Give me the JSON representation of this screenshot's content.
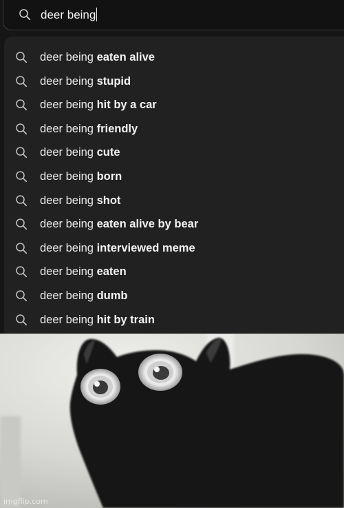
{
  "search": {
    "query": "deer being",
    "icon": "search-icon"
  },
  "suggestions": [
    {
      "prefix": "deer being ",
      "completion": "eaten alive"
    },
    {
      "prefix": "deer being ",
      "completion": "stupid"
    },
    {
      "prefix": "deer being ",
      "completion": "hit by a car"
    },
    {
      "prefix": "deer being ",
      "completion": "friendly"
    },
    {
      "prefix": "deer being ",
      "completion": "cute"
    },
    {
      "prefix": "deer being ",
      "completion": "born"
    },
    {
      "prefix": "deer being ",
      "completion": "shot"
    },
    {
      "prefix": "deer being ",
      "completion": "eaten alive by bear"
    },
    {
      "prefix": "deer being ",
      "completion": "interviewed meme"
    },
    {
      "prefix": "deer being ",
      "completion": "eaten"
    },
    {
      "prefix": "deer being ",
      "completion": "dumb"
    },
    {
      "prefix": "deer being ",
      "completion": "hit by train"
    }
  ],
  "meme": {
    "description_icon": "wide-eyed-black-cat-image",
    "watermark": "imgflip.com"
  },
  "colors": {
    "panel_bg": "#161616",
    "dropdown_bg": "#212121",
    "text": "#eaeaea",
    "meme_bg": "#dcdcd8"
  }
}
